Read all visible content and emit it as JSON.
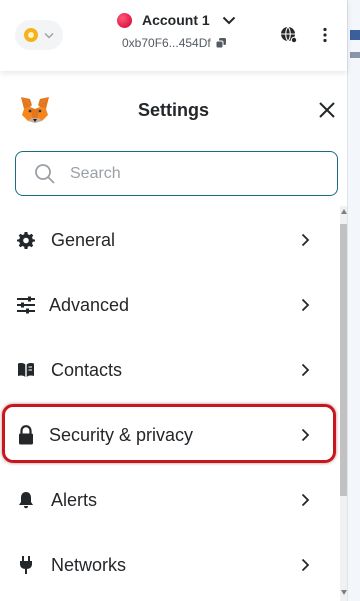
{
  "header": {
    "account_name": "Account 1",
    "address": "0xb70F6...454Df"
  },
  "settings": {
    "title": "Settings",
    "search_placeholder": "Search"
  },
  "menu": [
    {
      "label": "General",
      "icon": "gear-icon"
    },
    {
      "label": "Advanced",
      "icon": "sliders-icon"
    },
    {
      "label": "Contacts",
      "icon": "book-icon"
    },
    {
      "label": "Security & privacy",
      "icon": "lock-icon",
      "highlighted": true
    },
    {
      "label": "Alerts",
      "icon": "bell-icon"
    },
    {
      "label": "Networks",
      "icon": "plug-icon"
    }
  ],
  "colors": {
    "highlight": "#c8161d",
    "search_border": "#1b6c7e",
    "account_dot": "#e51f4d",
    "network_dot": "#f5b21b"
  }
}
